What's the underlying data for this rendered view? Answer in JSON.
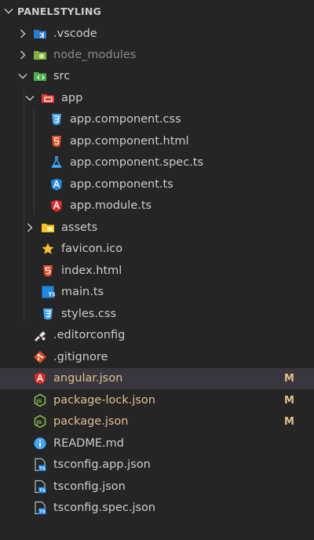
{
  "explorer": {
    "section_title": "PANELSTYLING",
    "rows": [
      {
        "label": "vscode-folder",
        "text": ".vscode",
        "badge": ""
      },
      {
        "label": "node_modules",
        "text": "node_modules",
        "badge": ""
      },
      {
        "label": "src",
        "text": "src",
        "badge": ""
      },
      {
        "label": "app",
        "text": "app",
        "badge": ""
      },
      {
        "label": "css",
        "text": "app.component.css",
        "badge": ""
      },
      {
        "label": "html",
        "text": "app.component.html",
        "badge": ""
      },
      {
        "label": "spec",
        "text": "app.component.spec.ts",
        "badge": ""
      },
      {
        "label": "comp",
        "text": "app.component.ts",
        "badge": ""
      },
      {
        "label": "module",
        "text": "app.module.ts",
        "badge": ""
      },
      {
        "label": "assets",
        "text": "assets",
        "badge": ""
      },
      {
        "label": "favicon",
        "text": "favicon.ico",
        "badge": ""
      },
      {
        "label": "index",
        "text": "index.html",
        "badge": ""
      },
      {
        "label": "main",
        "text": "main.ts",
        "badge": ""
      },
      {
        "label": "styles",
        "text": "styles.css",
        "badge": ""
      },
      {
        "label": "editorconfig",
        "text": ".editorconfig",
        "badge": ""
      },
      {
        "label": "gitignore",
        "text": ".gitignore",
        "badge": ""
      },
      {
        "label": "angular",
        "text": "angular.json",
        "badge": "M"
      },
      {
        "label": "packagelock",
        "text": "package-lock.json",
        "badge": "M"
      },
      {
        "label": "package",
        "text": "package.json",
        "badge": "M"
      },
      {
        "label": "readme",
        "text": "README.md",
        "badge": ""
      },
      {
        "label": "tsapp",
        "text": "tsconfig.app.json",
        "badge": ""
      },
      {
        "label": "tsconfig",
        "text": "tsconfig.json",
        "badge": ""
      },
      {
        "label": "tsspec",
        "text": "tsconfig.spec.json",
        "badge": ""
      }
    ]
  },
  "colors": {
    "background": "#252526",
    "selected_row": "#37373d",
    "text": "#cccccc",
    "modified": "#e2c08d",
    "dim": "#8a8a8a"
  }
}
